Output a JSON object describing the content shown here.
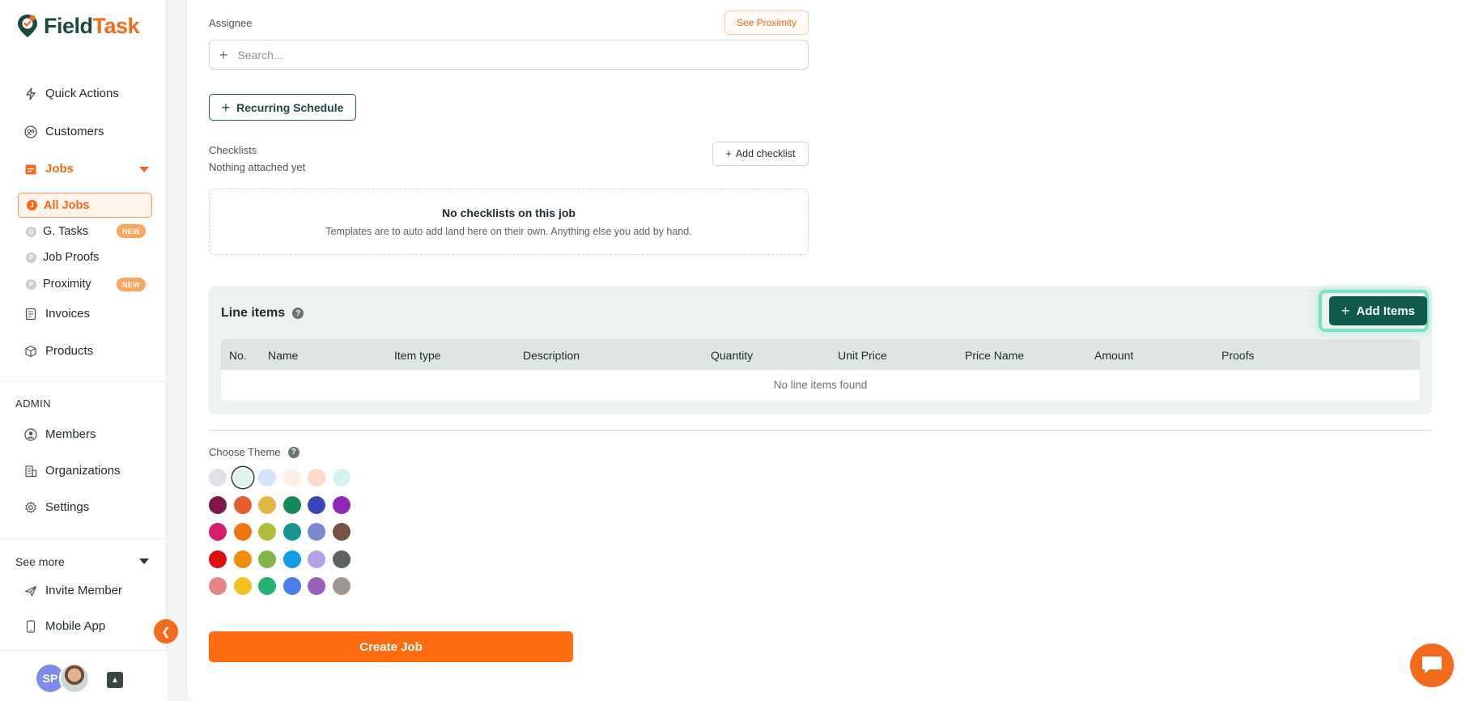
{
  "brand": {
    "name_part1": "Field",
    "name_part2": "Task"
  },
  "sidebar": {
    "nav": [
      {
        "label": "Quick Actions",
        "icon": "bolt-icon"
      },
      {
        "label": "Customers",
        "icon": "users-icon"
      },
      {
        "label": "Jobs",
        "icon": "calendar-icon"
      }
    ],
    "jobs_sub": [
      {
        "label": "All Jobs"
      },
      {
        "label": "G. Tasks",
        "badge": "NEW"
      },
      {
        "label": "Job Proofs"
      },
      {
        "label": "Proximity",
        "badge": "NEW"
      }
    ],
    "nav2": [
      {
        "label": "Invoices",
        "icon": "invoice-icon"
      },
      {
        "label": "Products",
        "icon": "box-icon"
      }
    ],
    "admin_label": "ADMIN",
    "admin": [
      {
        "label": "Members",
        "icon": "member-icon"
      },
      {
        "label": "Organizations",
        "icon": "building-icon"
      },
      {
        "label": "Settings",
        "icon": "gear-icon"
      }
    ],
    "see_more": "See more",
    "more": [
      {
        "label": "Invite Member",
        "icon": "plane-icon"
      },
      {
        "label": "Mobile App",
        "icon": "phone-icon"
      }
    ],
    "user_initials": "SP"
  },
  "form": {
    "assignee_label": "Assignee",
    "see_proximity": "See Proximity",
    "search_placeholder": "Search...",
    "recurring_label": "Recurring Schedule",
    "checklists_label": "Checklists",
    "checklists_sub": "Nothing attached yet",
    "add_checklist": "Add checklist",
    "empty_title": "No checklists on this job",
    "empty_sub": "Templates are to auto add land here on their own. Anything else you add by hand."
  },
  "line_items": {
    "title": "Line items",
    "add_button": "Add Items",
    "columns": [
      "No.",
      "Name",
      "Item type",
      "Description",
      "Quantity",
      "Unit Price",
      "Price Name",
      "Amount",
      "Proofs"
    ],
    "empty": "No line items found"
  },
  "theme": {
    "label": "Choose Theme",
    "colors": [
      [
        "#dfe1e6",
        "#dff3ef",
        "#d5e3fb",
        "#fdf0e6",
        "#fcd9c8",
        "#d6f2ee"
      ],
      [
        "#7a1848",
        "#e65c2a",
        "#e3b64a",
        "#138a5e",
        "#3b47b8",
        "#8f27b4"
      ],
      [
        "#d41e6a",
        "#f0740f",
        "#b4bd3a",
        "#169594",
        "#7a88d0",
        "#7a5040"
      ],
      [
        "#d90f12",
        "#f18c0a",
        "#84b548",
        "#109ee6",
        "#b4a2e4",
        "#5e6161"
      ],
      [
        "#e68486",
        "#f1c223",
        "#25b375",
        "#4b7ee8",
        "#9860b8",
        "#a09590"
      ]
    ],
    "selected": "1,0"
  },
  "create_job": "Create Job",
  "colors": {
    "accent": "#f26b1d",
    "primary": "#0f5a4b"
  }
}
